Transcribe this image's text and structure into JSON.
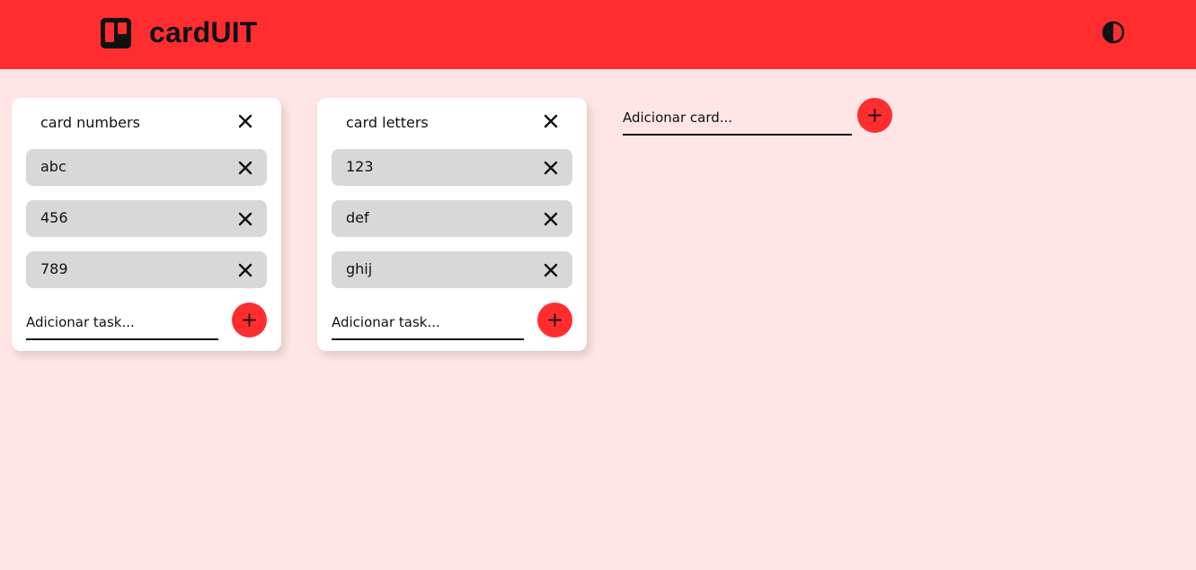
{
  "header": {
    "app_name": "cardUIT",
    "logo_icon": "kanban-board-icon",
    "theme_toggle_icon": "contrast-half-circle-icon",
    "background_color": "#ff2d2f"
  },
  "board": {
    "background_color": "#ffe5e5",
    "cards": [
      {
        "title": "card numbers",
        "tasks": [
          {
            "label": "abc"
          },
          {
            "label": "456"
          },
          {
            "label": "789"
          }
        ],
        "add_task_placeholder": "Adicionar task..."
      },
      {
        "title": "card letters",
        "tasks": [
          {
            "label": "123"
          },
          {
            "label": "def"
          },
          {
            "label": "ghij"
          }
        ],
        "add_task_placeholder": "Adicionar task..."
      }
    ],
    "add_card_placeholder": "Adicionar card...",
    "accent_color": "#ff2d2f",
    "task_background_color": "#d8d8d8"
  }
}
